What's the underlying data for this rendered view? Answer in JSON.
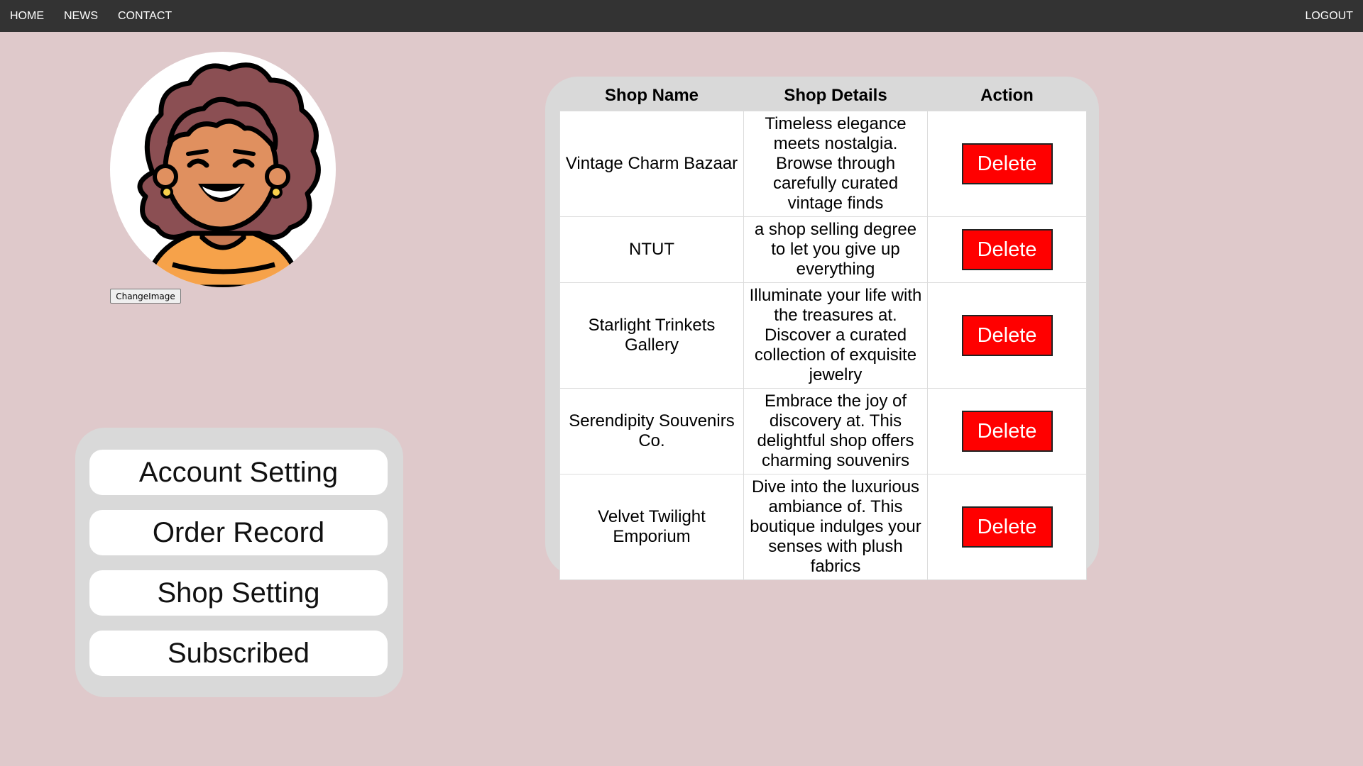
{
  "nav": {
    "home": "HOME",
    "news": "NEWS",
    "contact": "CONTACT",
    "logout": "LOGOUT"
  },
  "profile": {
    "change_image_label": "ChangeImage",
    "avatar_icon": "smiling-woman-avatar"
  },
  "menu": {
    "account_setting": "Account Setting",
    "order_record": "Order Record",
    "shop_setting": "Shop Setting",
    "subscribed": "Subscribed"
  },
  "table": {
    "headers": [
      "Shop Name",
      "Shop Details",
      "Action"
    ],
    "rows": [
      {
        "name": "Vintage Charm Bazaar",
        "details": "Timeless elegance meets nostalgia. Browse through carefully curated vintage finds",
        "action": "Delete"
      },
      {
        "name": "NTUT",
        "details": "a shop selling degree to let you give up everything",
        "action": "Delete"
      },
      {
        "name": "Starlight Trinkets Gallery",
        "details": "Illuminate your life with the treasures at. Discover a curated collection of exquisite jewelry",
        "action": "Delete"
      },
      {
        "name": "Serendipity Souvenirs Co.",
        "details": "Embrace the joy of discovery at. This delightful shop offers charming souvenirs",
        "action": "Delete"
      },
      {
        "name": "Velvet Twilight Emporium",
        "details": "Dive into the luxurious ambiance of. This boutique indulges your senses with plush fabrics",
        "action": "Delete"
      }
    ]
  },
  "colors": {
    "background": "#dfc9cb",
    "navbar": "#333333",
    "panel": "#d9d9d9",
    "delete": "#ff0000"
  }
}
